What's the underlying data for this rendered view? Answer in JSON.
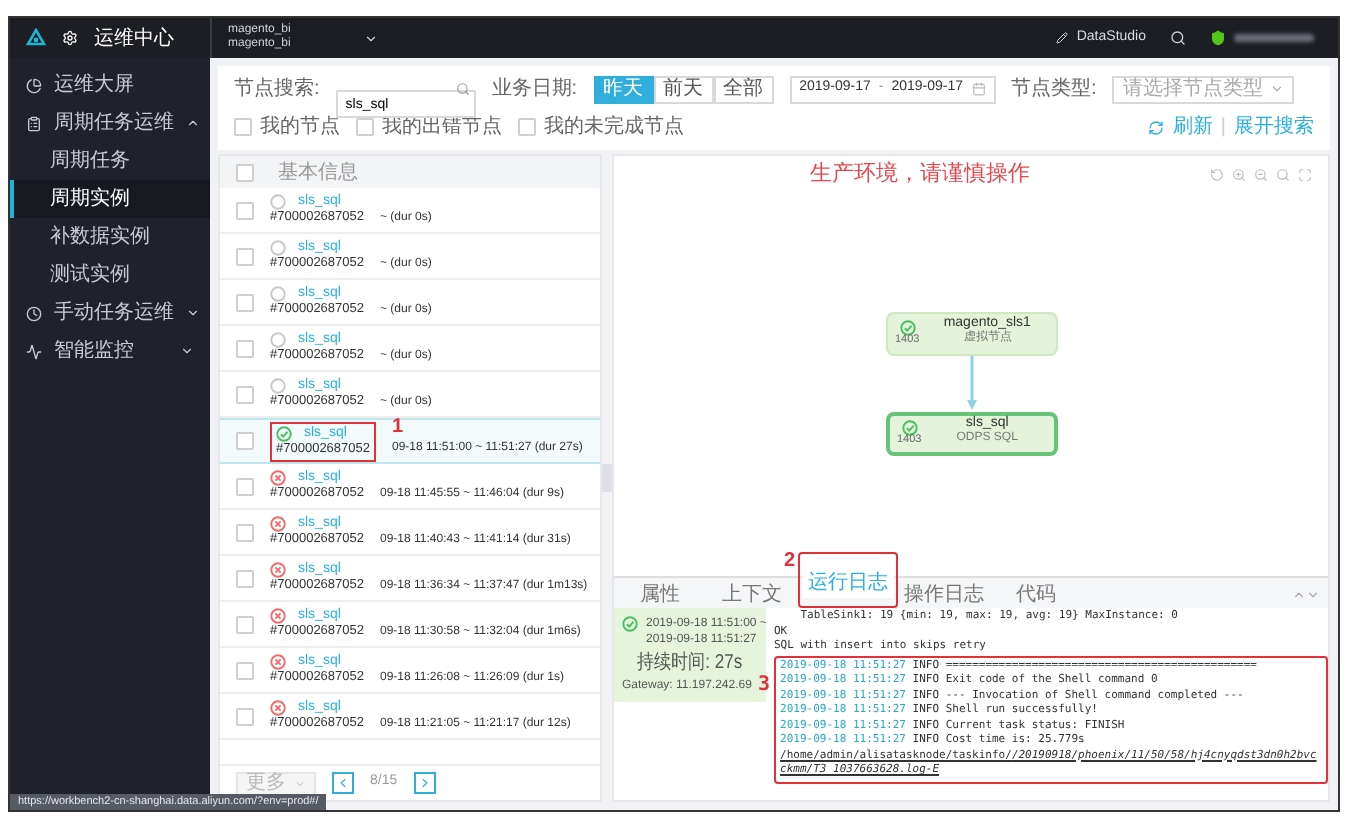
{
  "top_bar": {
    "app_title": "运维中心",
    "project": {
      "line_1": "magento_bi",
      "line_2": "magento_bi"
    },
    "studio_link": "DataStudio"
  },
  "sidebar": {
    "items": [
      {
        "label": "运维大屏",
        "selected": false
      },
      {
        "label": "周期任务运维",
        "selected": false,
        "expanded": true,
        "children": [
          {
            "label": "周期任务",
            "selected": false
          },
          {
            "label": "周期实例",
            "selected": true
          },
          {
            "label": "补数据实例",
            "selected": false
          },
          {
            "label": "测试实例",
            "selected": false
          }
        ]
      },
      {
        "label": "手动任务运维",
        "selected": false,
        "expanded": false
      },
      {
        "label": "智能监控",
        "selected": false,
        "expanded": false
      }
    ]
  },
  "toolbar": {
    "search": {
      "label": "节点搜索:",
      "value": "sls_sql"
    },
    "date": {
      "label": "业务日期:",
      "options": [
        {
          "label": "昨天",
          "selected": true
        },
        {
          "label": "前天",
          "selected": false
        },
        {
          "label": "全部",
          "selected": false
        }
      ],
      "start": "2019-09-17",
      "separator": "-",
      "end": "2019-09-17"
    },
    "node_type": {
      "label": "节点类型:",
      "placeholder": "请选择节点类型"
    },
    "filters": [
      {
        "label": "我的节点",
        "checked": false
      },
      {
        "label": "我的出错节点",
        "checked": false
      },
      {
        "label": "我的未完成节点",
        "checked": false
      }
    ],
    "links": [
      "刷新",
      "|",
      "展开搜索"
    ]
  },
  "instance_list": {
    "header": {
      "label": "基本信息",
      "checked": false
    },
    "rows": [
      {
        "name": "sls_sql",
        "id": "#700002687052",
        "time": "~ (dur 0s)",
        "kind": "pending",
        "checked": false,
        "selected": false
      },
      {
        "name": "sls_sql",
        "id": "#700002687052",
        "time": "~ (dur 0s)",
        "kind": "pending",
        "checked": false,
        "selected": false
      },
      {
        "name": "sls_sql",
        "id": "#700002687052",
        "time": "~ (dur 0s)",
        "kind": "pending",
        "checked": false,
        "selected": false
      },
      {
        "name": "sls_sql",
        "id": "#700002687052",
        "time": "~ (dur 0s)",
        "kind": "pending",
        "checked": false,
        "selected": false
      },
      {
        "name": "sls_sql",
        "id": "#700002687052",
        "time": "~ (dur 0s)",
        "kind": "pending",
        "checked": false,
        "selected": false
      },
      {
        "name": "sls_sql",
        "id": "#700002687052",
        "time": "09-18 11:51:00 ~ 11:51:27 (dur 27s)",
        "kind": "success",
        "checked": false,
        "selected": true
      },
      {
        "name": "sls_sql",
        "id": "#700002687052",
        "time": "09-18 11:45:55 ~ 11:46:04 (dur 9s)",
        "kind": "failed",
        "checked": false,
        "selected": false
      },
      {
        "name": "sls_sql",
        "id": "#700002687052",
        "time": "09-18 11:40:43 ~ 11:41:14 (dur 31s)",
        "kind": "failed",
        "checked": false,
        "selected": false
      },
      {
        "name": "sls_sql",
        "id": "#700002687052",
        "time": "09-18 11:36:34 ~ 11:37:47 (dur 1m13s)",
        "kind": "failed",
        "checked": false,
        "selected": false
      },
      {
        "name": "sls_sql",
        "id": "#700002687052",
        "time": "09-18 11:30:58 ~ 11:32:04 (dur 1m6s)",
        "kind": "failed",
        "checked": false,
        "selected": false
      },
      {
        "name": "sls_sql",
        "id": "#700002687052",
        "time": "09-18 11:26:08 ~ 11:26:09 (dur 1s)",
        "kind": "failed",
        "checked": false,
        "selected": false
      },
      {
        "name": "sls_sql",
        "id": "#700002687052",
        "time": "09-18 11:21:05 ~ 11:21:17 (dur 12s)",
        "kind": "failed",
        "checked": false,
        "selected": false
      }
    ],
    "pagination": {
      "more": "更多",
      "page": "8/15"
    }
  },
  "graph": {
    "warning": "生产环境，请谨慎操作",
    "nodes": [
      {
        "name": "magento_sls1",
        "id": "1403",
        "type": "虚拟节点",
        "kind": "success",
        "selected": false
      },
      {
        "name": "sls_sql",
        "id": "1403",
        "type": "ODPS SQL",
        "kind": "success",
        "selected": true
      }
    ]
  },
  "details": {
    "tabs": [
      {
        "label": "属性",
        "selected": false
      },
      {
        "label": "上下文",
        "selected": false
      },
      {
        "label": "运行日志",
        "selected": true
      },
      {
        "label": "操作日志",
        "selected": false
      },
      {
        "label": "代码",
        "selected": false
      }
    ],
    "summary": {
      "time_start": "2019-09-18 11:51:00 ~",
      "time_end": "2019-09-18 11:51:27",
      "duration": "持续时间: 27s",
      "gateway": "Gateway: 11.197.242.69",
      "kind": "success"
    },
    "log": [
      {
        "kind": "plain",
        "text": "    TableSink1: 19 {min: 19, max: 19, avg: 19} MaxInstance: 0"
      },
      {
        "kind": "plain",
        "text": "OK"
      },
      {
        "kind": "plain",
        "text": "SQL with insert into skips retry"
      },
      {
        "kind": "info",
        "timestamp": "2019-09-18 11:51:27",
        "text": "INFO ==============================================="
      },
      {
        "kind": "info",
        "timestamp": "2019-09-18 11:51:27",
        "text": "INFO Exit code of the Shell command 0"
      },
      {
        "kind": "info",
        "timestamp": "2019-09-18 11:51:27",
        "text": "INFO --- Invocation of Shell command completed ---"
      },
      {
        "kind": "info",
        "timestamp": "2019-09-18 11:51:27",
        "text": "INFO Shell run successfully!"
      },
      {
        "kind": "info",
        "timestamp": "2019-09-18 11:51:27",
        "text": "INFO Current task status: FINISH"
      },
      {
        "kind": "info",
        "timestamp": "2019-09-18 11:51:27",
        "text": "INFO Cost time is: 25.779s"
      },
      {
        "kind": "path",
        "text": "/home/admin/alisatasknode/taskinfo/*/20190918/phoenix/11/50/58/hj4cnyqdst3dn0h2bvcckmm/T3_1037663628.log-E*"
      }
    ]
  },
  "annotations": [
    {
      "label": "1"
    },
    {
      "label": "2"
    },
    {
      "label": "3"
    }
  ],
  "status_bar": {
    "url": "https://workbench2-cn-shanghai.data.aliyun.com/?env=prod#/"
  }
}
